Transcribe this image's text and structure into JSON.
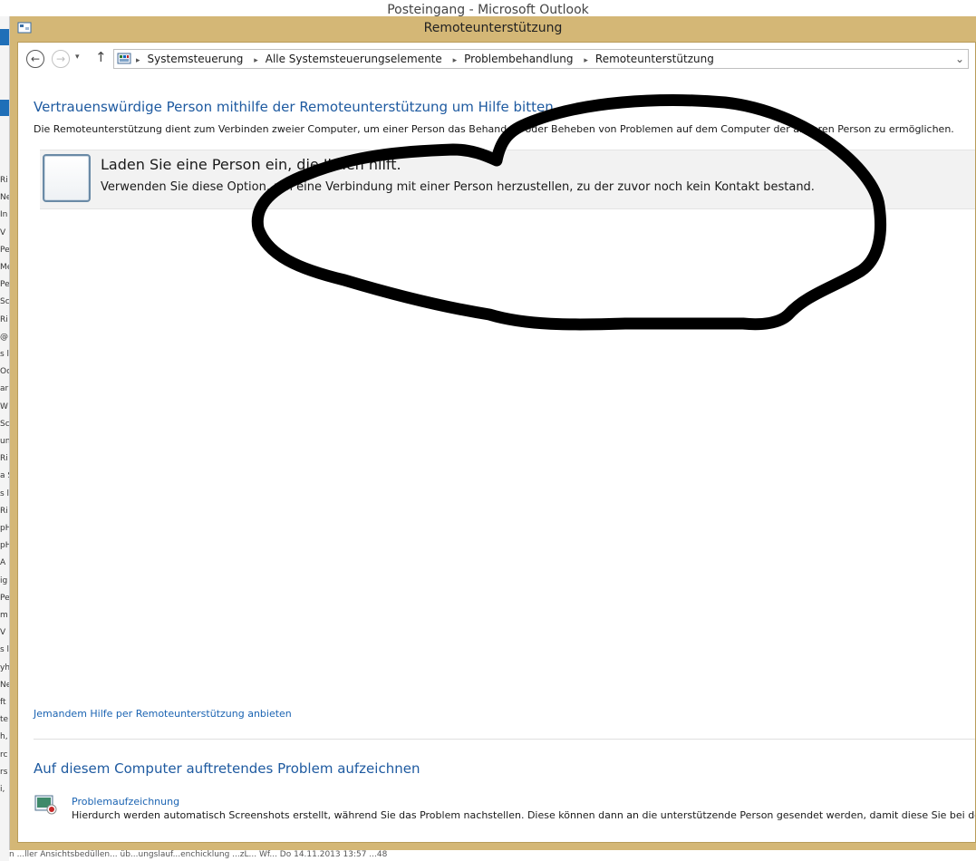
{
  "background_window": {
    "title": "Posteingang - Microsoft Outlook",
    "left_fragments": [
      "Ri",
      "Ne",
      "In",
      "V",
      "Pe",
      "Me",
      "Pe",
      "Sc",
      "Ri",
      "@",
      "s l",
      "Oc",
      "ar",
      "W",
      "Sc",
      "un",
      "Ri",
      "a S",
      "s l",
      "Ri",
      "pH",
      "pH",
      "A",
      "ig",
      "Pe",
      "m",
      "V",
      "s l",
      "yh",
      "Ne",
      "ft",
      "te",
      "h,",
      "rc",
      "rs",
      "i,"
    ],
    "bottom_text": "n                ...ller Ansichtsbedüllen...  üb...ungslauf...enchicklung  ...zL...  Wf...  Do 14.11.2013 13:57   ...48"
  },
  "window": {
    "title": "Remoteunterstützung"
  },
  "navigation": {
    "back": "←",
    "forward": "→",
    "dropdown": "▾",
    "up": "↑",
    "breadcrumbs": [
      "Systemsteuerung",
      "Alle Systemsteuerungselemente",
      "Problembehandlung",
      "Remoteunterstützung"
    ],
    "separator": "▸",
    "address_dropdown": "⌄"
  },
  "main": {
    "heading": "Vertrauenswürdige Person mithilfe der Remoteunterstützung um Hilfe bitten.",
    "description": "Die Remoteunterstützung dient zum Verbinden zweier Computer, um einer Person das Behandeln oder Beheben von Problemen auf dem Computer der anderen Person zu ermöglichen.",
    "option": {
      "title": "Laden Sie eine Person ein, die Ihnen hilft.",
      "description": "Verwenden Sie diese Option, um eine Verbindung mit einer Person herzustellen, zu der zuvor noch kein Kontakt bestand."
    }
  },
  "footer": {
    "offer_link": "Jemandem Hilfe per Remoteunterstützung anbieten",
    "section_heading": "Auf diesem Computer auftretendes Problem aufzeichnen",
    "record_link": "Problemaufzeichnung",
    "record_description": "Hierdurch werden automatisch Screenshots erstellt, während Sie das Problem nachstellen. Diese können dann an die unterstützende Person gesendet werden, damit diese Sie bei der Problemb"
  },
  "colors": {
    "window_frame": "#d4b776",
    "heading_blue": "#1e5aa0",
    "link_blue": "#1a63b2",
    "scribble": "#000000"
  }
}
